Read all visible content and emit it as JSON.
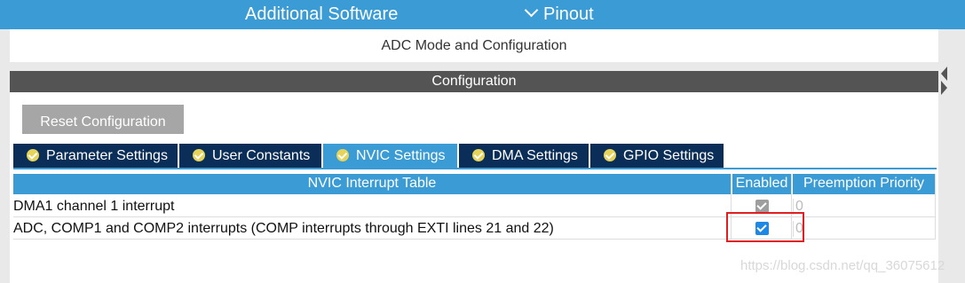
{
  "topbar": {
    "additional_software": "Additional Software",
    "pinout": "Pinout"
  },
  "mode_header": "ADC Mode and Configuration",
  "configuration": {
    "title": "Configuration",
    "reset_label": "Reset Configuration"
  },
  "tabs": [
    {
      "label": "Parameter Settings",
      "active": false
    },
    {
      "label": "User Constants",
      "active": false
    },
    {
      "label": "NVIC Settings",
      "active": true
    },
    {
      "label": "DMA Settings",
      "active": false
    },
    {
      "label": "GPIO Settings",
      "active": false
    }
  ],
  "table": {
    "headers": [
      "NVIC Interrupt Table",
      "Enabled",
      "Preemption Priority"
    ],
    "rows": [
      {
        "name": "DMA1 channel 1 interrupt",
        "enabled": true,
        "enabled_style": "grey",
        "priority": "0"
      },
      {
        "name": "ADC, COMP1 and COMP2 interrupts (COMP interrupts through EXTI lines 21 and 22)",
        "enabled": true,
        "enabled_style": "blue",
        "priority": "0"
      }
    ]
  },
  "watermark": "https://blog.csdn.net/qq_36075612",
  "colors": {
    "topbar": "#3a9bd5",
    "tab_inactive": "#0a2e57",
    "tab_active": "#3a9bd5",
    "config_bar": "#545454",
    "reset_button": "#a6a6a6",
    "highlight": "#e02020"
  }
}
